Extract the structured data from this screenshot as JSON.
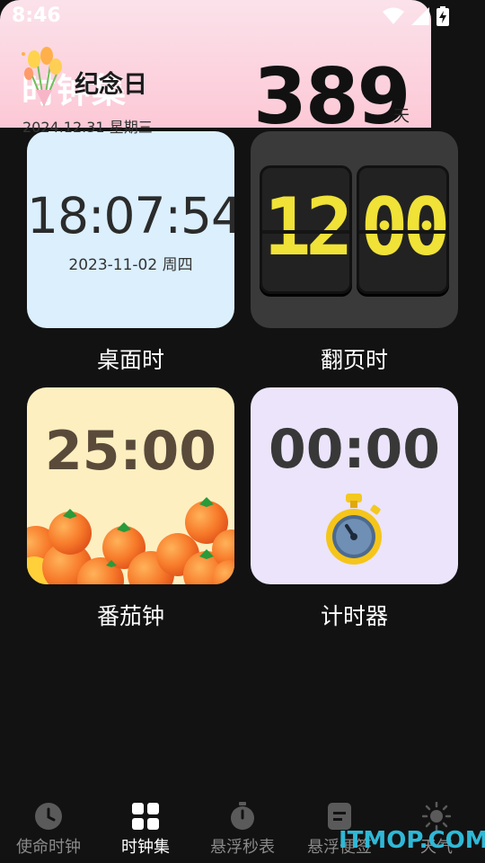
{
  "status_bar": {
    "time": "8:46"
  },
  "page": {
    "title": "时钟集"
  },
  "cards": {
    "desk": {
      "time": "18:07:54",
      "date": "2023-11-02 周四",
      "label": "桌面时"
    },
    "flip": {
      "hours": "12",
      "minutes": "00",
      "label": "翻页时"
    },
    "tomato": {
      "time": "25:00",
      "label": "番茄钟"
    },
    "timer": {
      "time": "00:00",
      "label": "计时器"
    },
    "anniversary": {
      "title": "纪念日",
      "date": "2024.12.31  星期三",
      "days": "389",
      "unit": "天"
    }
  },
  "nav": {
    "items": [
      {
        "label": "使命时钟",
        "icon": "clock-icon",
        "active": false
      },
      {
        "label": "时钟集",
        "icon": "grid-icon",
        "active": true
      },
      {
        "label": "悬浮秒表",
        "icon": "stopwatch-icon",
        "active": false
      },
      {
        "label": "悬浮便签",
        "icon": "note-icon",
        "active": false
      },
      {
        "label": "天气",
        "icon": "sun-icon",
        "active": false
      }
    ]
  },
  "watermark": "ITMOP.COM",
  "colors": {
    "background": "#121212",
    "desk_card": "#dbeffd",
    "flip_card": "#3a3a3a",
    "flip_digit": "#f0e237",
    "tomato_card": "#fdefc0",
    "timer_card": "#ebe4fb",
    "anniversary_card": "#fcc8d6",
    "watermark": "#2fb8d6"
  }
}
